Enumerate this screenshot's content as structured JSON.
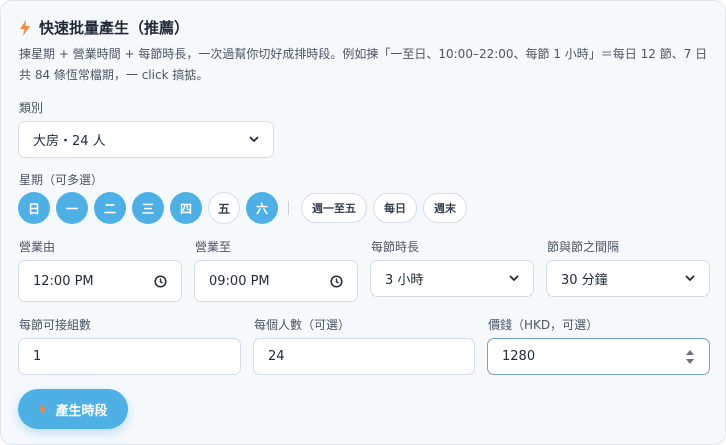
{
  "title": "快速批量產生（推薦）",
  "description": "揀星期 + 營業時間 + 每節時長，一次過幫你切好成排時段。例如揀「一至日、10:00–22:00、每節 1 小時」＝每日 12 節、7 日共 84 條恆常檔期，一 click 搞掂。",
  "category": {
    "label": "類別",
    "value": "大房・24 人"
  },
  "weekdays": {
    "label": "星期（可多選）",
    "days": [
      {
        "label": "日",
        "selected": true
      },
      {
        "label": "一",
        "selected": true
      },
      {
        "label": "二",
        "selected": true
      },
      {
        "label": "三",
        "selected": true
      },
      {
        "label": "四",
        "selected": true
      },
      {
        "label": "五",
        "selected": false
      },
      {
        "label": "六",
        "selected": true
      }
    ],
    "presets": [
      "週一至五",
      "每日",
      "週末"
    ]
  },
  "open_from": {
    "label": "營業由",
    "value": "12:00 PM"
  },
  "open_to": {
    "label": "營業至",
    "value": "09:00 PM"
  },
  "slot_length": {
    "label": "每節時長",
    "value": "3 小時"
  },
  "gap": {
    "label": "節與節之間隔",
    "value": "30 分鐘"
  },
  "groups": {
    "label": "每節可接組數",
    "value": "1"
  },
  "people": {
    "label": "每個人數（可選）",
    "value": "24"
  },
  "price": {
    "label": "價錢（HKD，可選）",
    "value": "1280"
  },
  "generate_button": "產生時段",
  "colors": {
    "accent": "#4fb0e6",
    "bolt": "#f08a3c"
  }
}
